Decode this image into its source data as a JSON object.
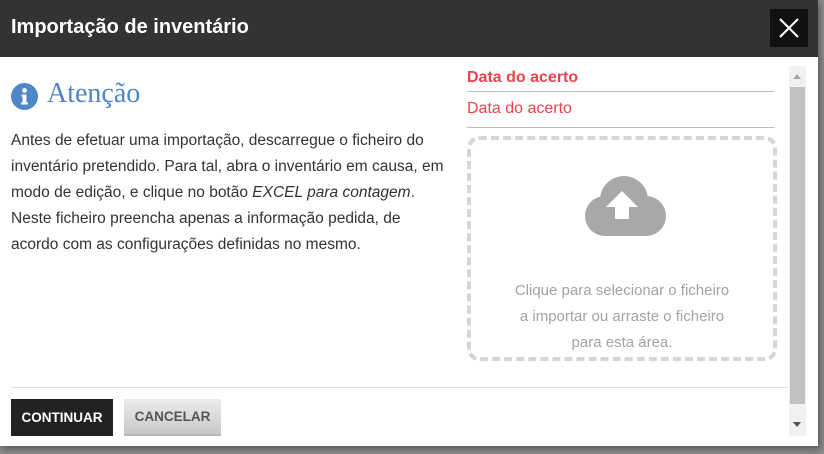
{
  "dialog": {
    "title": "Importação de inventário",
    "close_icon": "close-icon"
  },
  "notice": {
    "icon": "info-icon",
    "title": "Atenção",
    "text_1": "Antes de efetuar uma importação, descarregue o ficheiro do inventário pretendido. Para tal, abra o inventário em causa, em modo de edição, e clique no botão ",
    "text_emphasis": "EXCEL para contagem",
    "text_2": ". Neste ficheiro preencha apenas a informação pedida, de acordo com as configurações definidas no mesmo."
  },
  "form": {
    "date_label": "Data do acerto",
    "date_value": "Data do acerto"
  },
  "dropzone": {
    "icon": "cloud-upload-icon",
    "line_1": "Clique para selecionar o ficheiro",
    "line_2": "a importar ou arraste o ficheiro",
    "line_3": "para esta área."
  },
  "footer": {
    "continue_label": "CONTINUAR",
    "cancel_label": "CANCELAR"
  },
  "colors": {
    "titlebar": "#333333",
    "accent_blue": "#4f86c6",
    "accent_red": "#e9444b",
    "dropzone_border": "#d6d6d6",
    "button_primary": "#222222"
  }
}
